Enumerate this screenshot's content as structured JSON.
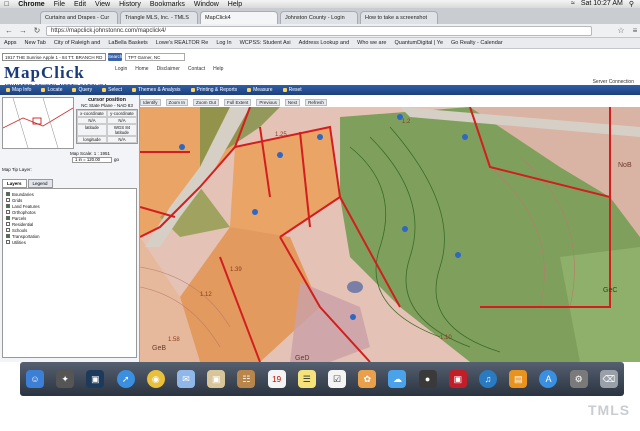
{
  "menubar": {
    "apple": "",
    "items": [
      "Chrome",
      "File",
      "Edit",
      "View",
      "History",
      "Bookmarks",
      "Window",
      "Help"
    ],
    "clock": "Sat 10:27 AM"
  },
  "tabs": [
    {
      "label": "Curtains and Drapes - Cur"
    },
    {
      "label": "Triangle MLS, Inc. - TMLS"
    },
    {
      "label": "MapClick4"
    },
    {
      "label": "Johnston County - Login"
    },
    {
      "label": "How to take a screenshot"
    }
  ],
  "addressbar": {
    "url": "https://mapclick.johnstonnc.com/mapclick4/"
  },
  "bookmarks": [
    "Apps",
    "New Tab",
    "City of Raleigh and",
    "LaBella Baskets",
    "Lowe's REALTOR Re",
    "Log In",
    "WCPSS: Student Asi",
    "Address Lookup and",
    "Who we are",
    "QuantumDigital | Ye",
    "Go Realty - Calendar"
  ],
  "site": {
    "search_value": "1917 THE Sunrise Apple 1 - 84 TT. BRANCH RD",
    "search_button": "Search",
    "bookmark_field": "TPT Garner, NC",
    "logo_title": "MapClick",
    "logo_sub": "JOHNSTON COUNTY, NORTH CAROLINA",
    "nav": [
      "Login",
      "Home",
      "Disclaimer",
      "Contact",
      "Help"
    ],
    "server": "Server Connection"
  },
  "appbar": [
    "Map Info",
    "Locate",
    "Query",
    "Select",
    "Themes & Analysis",
    "Printing & Reports",
    "Measure",
    "Reset"
  ],
  "maptools": [
    "Identify",
    "Zoom In",
    "Zoom Out",
    "Full Extent",
    "Previous",
    "Next",
    "Refresh"
  ],
  "sidepanel": {
    "cursor_title": "cursor position",
    "plane": "NC State Plane - NAD 83",
    "labels": [
      "x-coordinate",
      "y-coordinate"
    ],
    "values": [
      "N/A",
      "N/A"
    ],
    "latlong": [
      "latitude",
      "longitude"
    ],
    "wgs": [
      "WGS 84 latitude",
      "N/A"
    ],
    "map_scale_label": "Map Scale: 1 : 1951",
    "scale_value": "1 in = 120.00",
    "go": "go",
    "maptip": "Map Tip Layer:",
    "layer_tabs": [
      "Layers",
      "Legend"
    ],
    "layers": [
      "Boundaries",
      "Grids",
      "Land Features",
      "Orthophotos",
      "Parcels",
      "Residential",
      "Schools",
      "Transportation",
      "Utilities"
    ]
  },
  "dock": [
    "Finder",
    "Launchpad",
    "Mission Control",
    "Safari",
    "Chrome",
    "Mail",
    "Preview",
    "Contacts",
    "Calendar",
    "Notes",
    "Reminders",
    "Photos",
    "Messages",
    "FaceTime",
    "Photo Booth",
    "iTunes",
    "iBooks",
    "App Store",
    "System Preferences",
    "Trash"
  ],
  "map_labels": [
    "1.25",
    "1.2",
    "1.12",
    "1.39",
    "1.58",
    "GeB",
    "GeD",
    "NoB",
    "GeC",
    "1.10"
  ],
  "watermark": "TMLS"
}
